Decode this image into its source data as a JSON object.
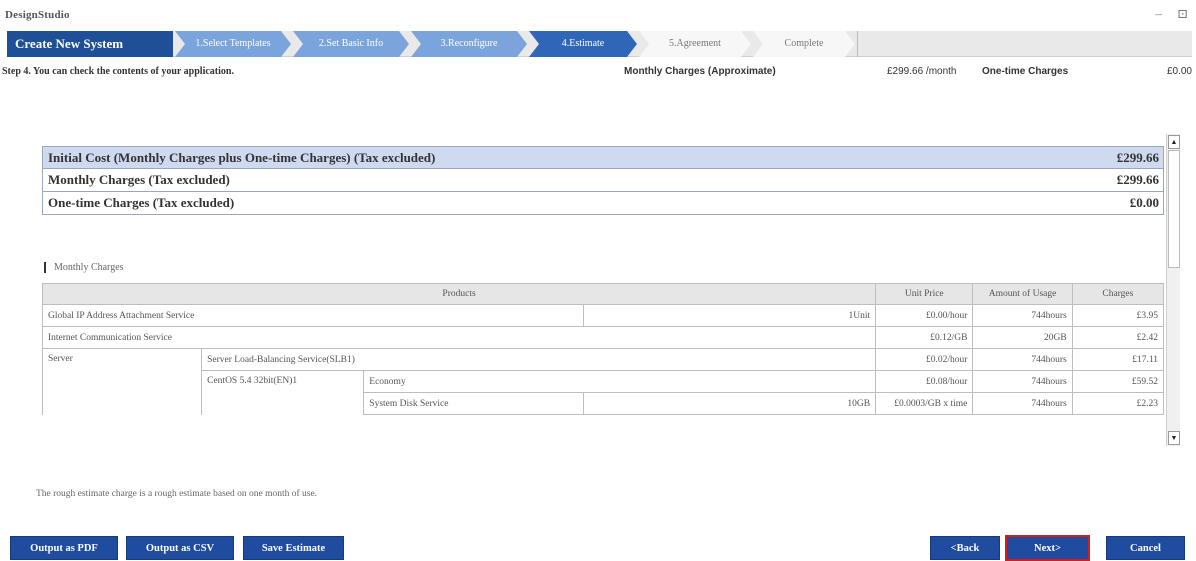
{
  "app": {
    "title": "DesignStudio",
    "minimize": "–",
    "restore": "⊡"
  },
  "wizard": {
    "create_new": "Create New System",
    "steps": [
      {
        "label": "1.Select Templates",
        "state": "done"
      },
      {
        "label": "2.Set Basic Info",
        "state": "done"
      },
      {
        "label": "3.Reconfigure",
        "state": "done"
      },
      {
        "label": "4.Estimate",
        "state": "active"
      },
      {
        "label": "5.Agreement",
        "state": "todo"
      },
      {
        "label": "Complete",
        "state": "todo"
      }
    ]
  },
  "info": {
    "step_desc": "Step 4. You can check the contents of your application.",
    "monthly_label": "Monthly Charges (Approximate)",
    "monthly_value": "£299.66 /month",
    "onetime_label": "One-time Charges",
    "onetime_value": "£0.00"
  },
  "summary": [
    {
      "label": "Initial Cost (Monthly Charges plus One-time Charges) (Tax excluded)",
      "amount": "£299.66"
    },
    {
      "label": "Monthly Charges (Tax excluded)",
      "amount": "£299.66"
    },
    {
      "label": "One-time Charges (Tax excluded)",
      "amount": "£0.00"
    }
  ],
  "monthly_heading": "Monthly Charges",
  "detail": {
    "headers": [
      "Products",
      "Unit Price",
      "Amount of Usage",
      "Charges"
    ],
    "rows": [
      {
        "product": "Global IP Address Attachment Service",
        "qty": "1Unit",
        "unit_price": "£0.00/hour",
        "usage": "744hours",
        "charge": "£3.95"
      },
      {
        "product": "Internet Communication Service",
        "unit_price": "£0.12/GB",
        "usage": "20GB",
        "charge": "£2.42"
      },
      {
        "category": "Server",
        "product": "Server Load-Balancing Service(SLB1)",
        "unit_price": "£0.02/hour",
        "usage": "744hours",
        "charge": "£17.11"
      },
      {
        "sub": "CentOS 5.4 32bit(EN)1",
        "product": "Economy",
        "unit_price": "£0.08/hour",
        "usage": "744hours",
        "charge": "£59.52"
      },
      {
        "product": "System Disk Service",
        "qty": "10GB",
        "unit_price": "£0.0003/GB x time",
        "usage": "744hours",
        "charge": "£2.23"
      }
    ]
  },
  "note": "The rough estimate charge is a rough estimate based on one month of use.",
  "buttons": {
    "output_pdf": "Output as PDF",
    "output_csv": "Output as CSV",
    "save_estimate": "Save Estimate",
    "back": "<Back",
    "next": "Next>",
    "cancel": "Cancel"
  },
  "scroll": {
    "up": "▲",
    "down": "▼"
  }
}
